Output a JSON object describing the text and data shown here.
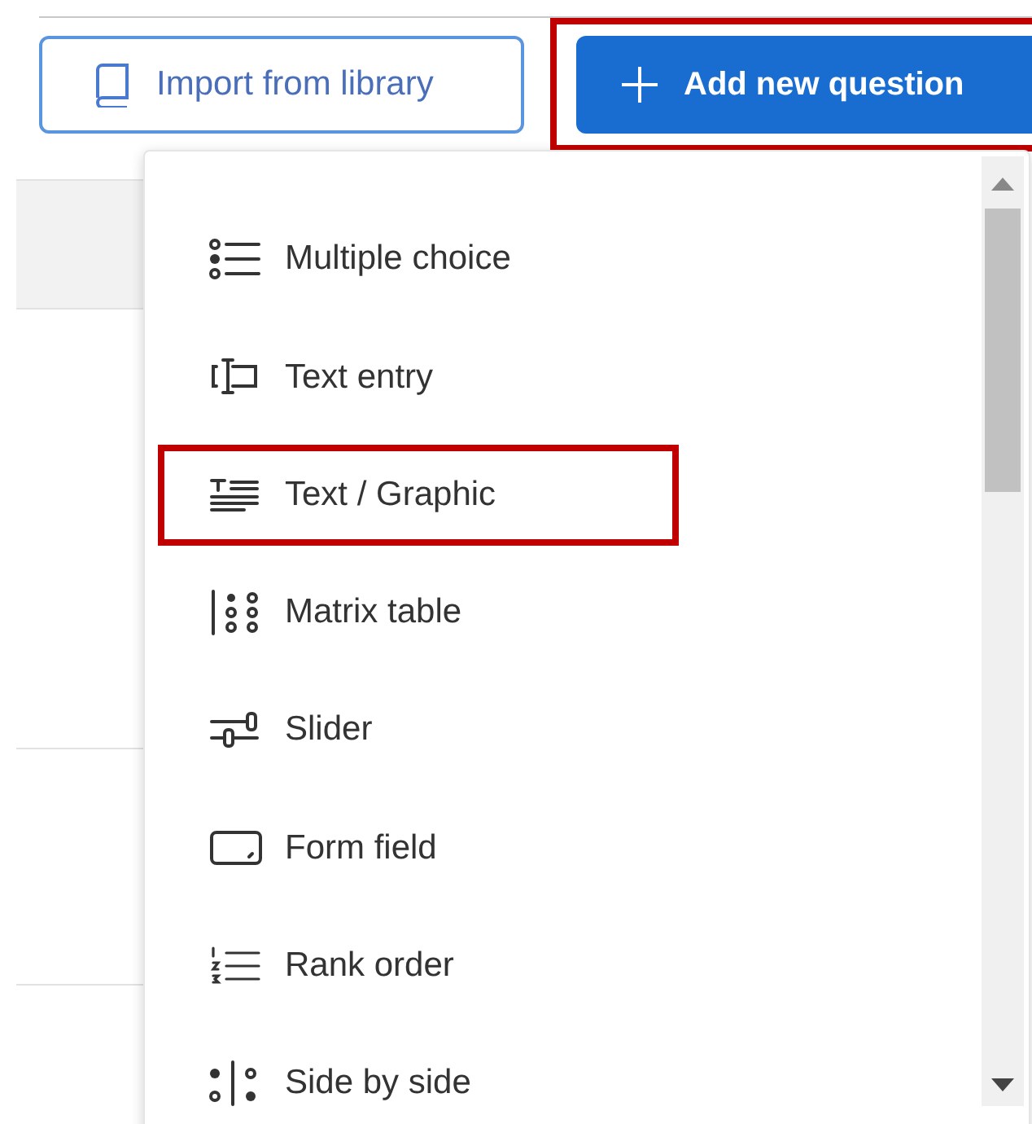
{
  "buttons": [
    {
      "kind": "outline",
      "label": "Import from library",
      "highlighted": false
    },
    {
      "kind": "primary",
      "label": "Add new question",
      "highlighted": true
    }
  ],
  "menu": {
    "items": [
      {
        "kind": "multiple",
        "label": "Multiple choice",
        "highlighted": false
      },
      {
        "kind": "textentry",
        "label": "Text entry",
        "highlighted": false
      },
      {
        "kind": "textgraphic",
        "label": "Text / Graphic",
        "highlighted": true
      },
      {
        "kind": "matrix",
        "label": "Matrix table",
        "highlighted": false
      },
      {
        "kind": "slider",
        "label": "Slider",
        "highlighted": false
      },
      {
        "kind": "formfield",
        "label": "Form field",
        "highlighted": false
      },
      {
        "kind": "rank",
        "label": "Rank order",
        "highlighted": false
      },
      {
        "kind": "sidebyside",
        "label": "Side by side",
        "highlighted": false
      }
    ]
  }
}
